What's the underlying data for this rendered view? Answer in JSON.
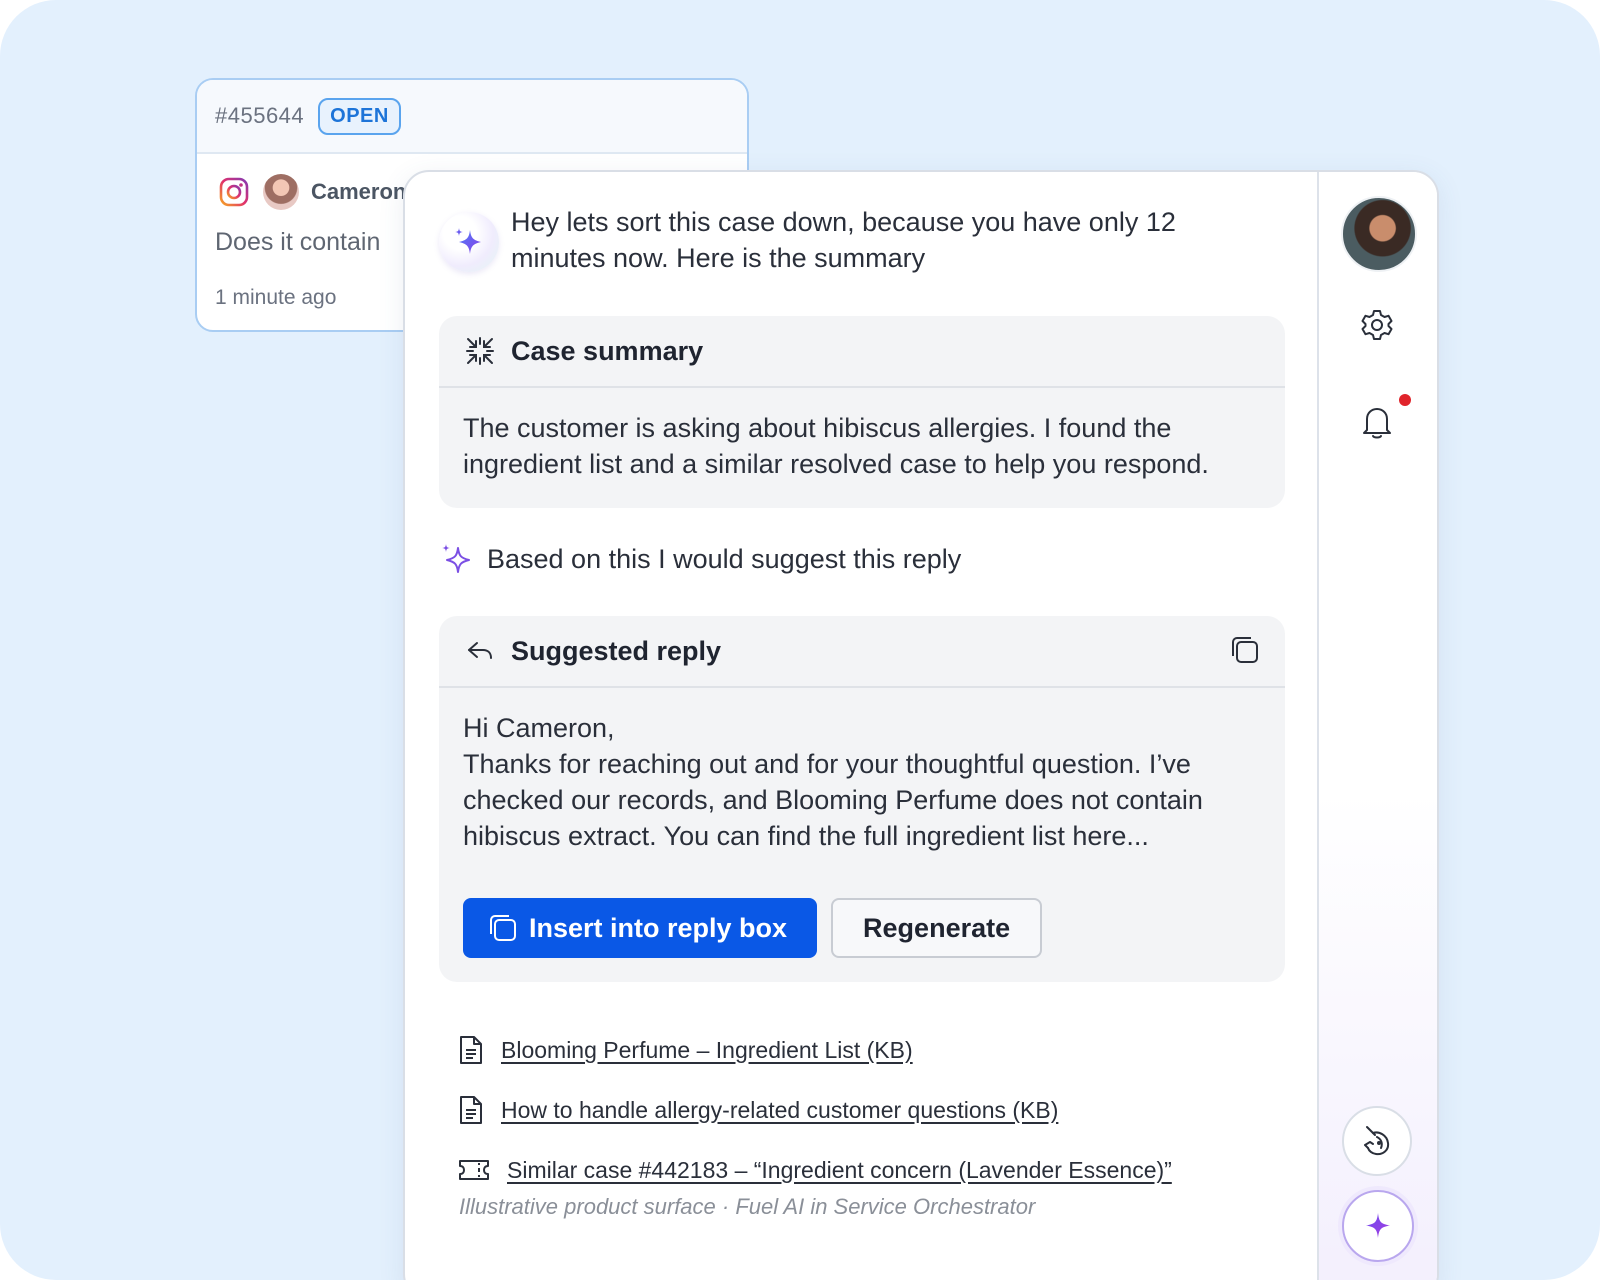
{
  "ticket": {
    "id": "#455644",
    "status": "OPEN",
    "channel_icon": "instagram-icon",
    "customer_name": "Cameron",
    "message_preview": "Does it contain",
    "time": "1 minute ago"
  },
  "assistant": {
    "greeting": "Hey lets sort this case down, because you have only 12 minutes now. Here is the summary",
    "summary": {
      "title": "Case summary",
      "body": "The customer is asking about hibiscus allergies. I found the ingredient list and a similar resolved case to help you respond."
    },
    "suggest_intro": "Based on this I would suggest this reply",
    "reply": {
      "title": "Suggested reply",
      "greeting_line": "Hi Cameron,",
      "body": "Thanks for reaching out and for your thoughtful question. I’ve checked our records, and Blooming Perfume does not contain hibiscus extract. You can find the full ingredient list here...",
      "insert_label": "Insert into reply box",
      "regenerate_label": "Regenerate"
    },
    "sources": [
      {
        "icon": "document-icon",
        "label": "Blooming Perfume – Ingredient List (KB)"
      },
      {
        "icon": "document-icon",
        "label": "How to handle allergy-related customer questions (KB)"
      },
      {
        "icon": "ticket-icon",
        "label": "Similar case #442183 – “Ingredient concern (Lavender Essence)”"
      }
    ],
    "footer_note": "Illustrative product surface · Fuel AI in Service Orchestrator"
  },
  "colors": {
    "background": "#e3f0fd",
    "primary_button": "#0a58e6",
    "open_badge": "#1d74d8",
    "ai_accent": "#6b3fe0",
    "notification": "#e0242b"
  }
}
